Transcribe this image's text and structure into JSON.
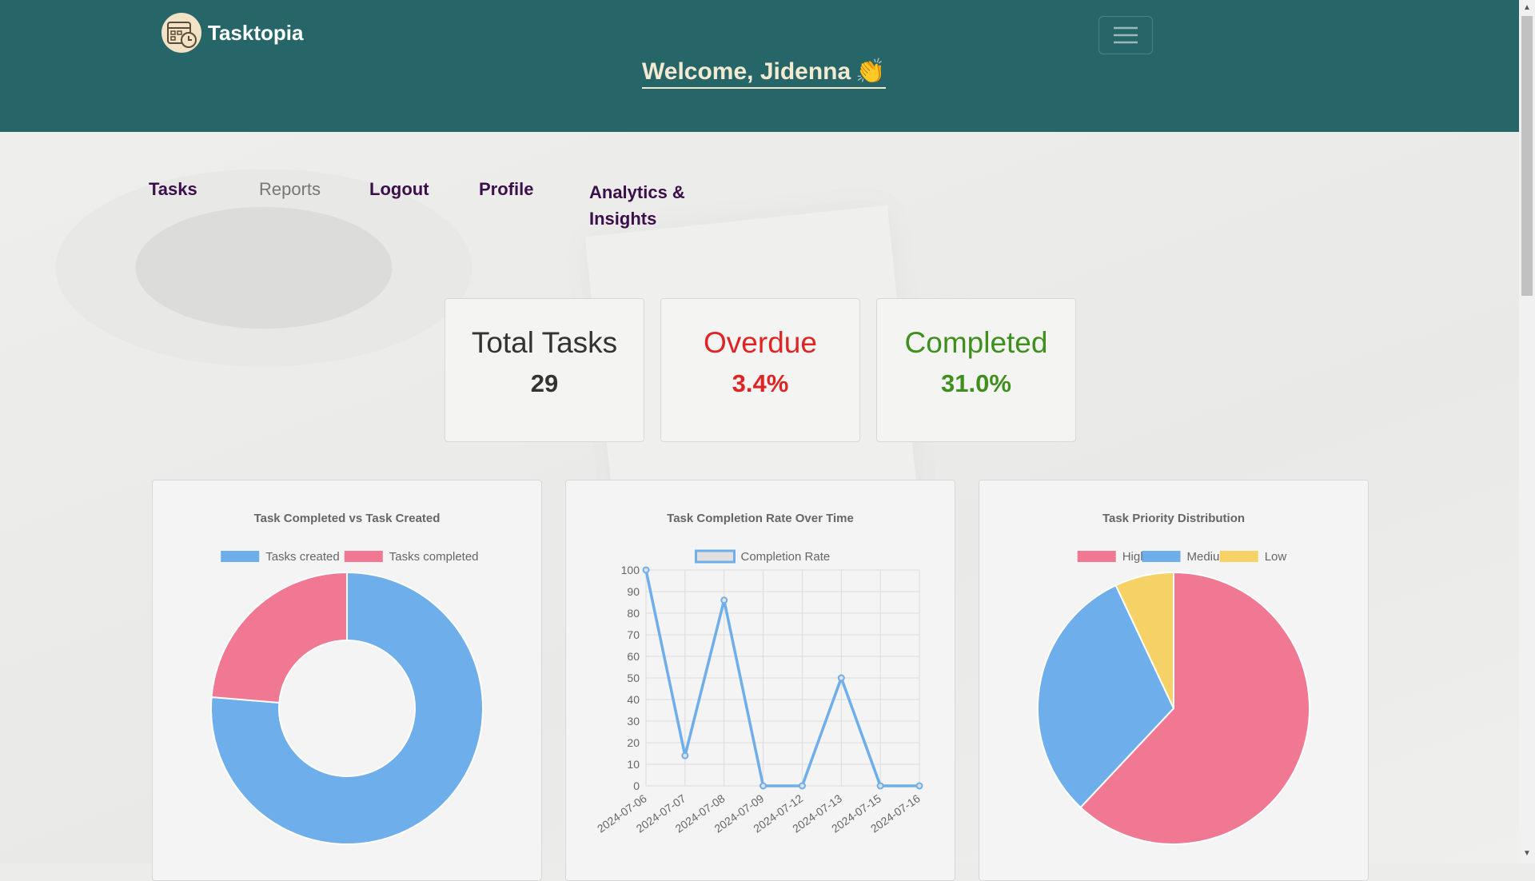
{
  "header": {
    "brand_name": "Tasktopia",
    "welcome": "Welcome, Jidenna",
    "welcome_emoji": "👏",
    "menu_icon": "hamburger-icon",
    "bg_color": "#276668"
  },
  "nav": {
    "items": [
      {
        "label": "Tasks"
      },
      {
        "label": "Reports"
      },
      {
        "label": "Logout"
      },
      {
        "label": "Profile"
      },
      {
        "label": "Analytics &"
      },
      {
        "label": "Insights"
      }
    ]
  },
  "stats": [
    {
      "title": "Total Tasks",
      "value": "29",
      "color": "#333333"
    },
    {
      "title": "Overdue",
      "value": "3.4%",
      "color": "#e02424"
    },
    {
      "title": "Completed",
      "value": "31.0%",
      "color": "#3f8f1f"
    }
  ],
  "chart_data": [
    {
      "type": "pie",
      "variant": "doughnut",
      "title": "Task Completed vs Task Created",
      "categories": [
        "Tasks created",
        "Tasks completed"
      ],
      "values": [
        29,
        9
      ],
      "colors": [
        "#6eaeea",
        "#f07892"
      ],
      "legend": "top"
    },
    {
      "type": "line",
      "title": "Task Completion Rate Over Time",
      "x": [
        "2024-07-06",
        "2024-07-07",
        "2024-07-08",
        "2024-07-09",
        "2024-07-12",
        "2024-07-13",
        "2024-07-15",
        "2024-07-16"
      ],
      "series": [
        {
          "name": "Completion Rate",
          "values": [
            100,
            14,
            86,
            0,
            0,
            50,
            0,
            0
          ]
        }
      ],
      "ylim": [
        0,
        100
      ],
      "yticks": [
        "0",
        "10",
        "20",
        "30",
        "40",
        "50",
        "60",
        "70",
        "80",
        "90",
        "100"
      ],
      "grid": true,
      "legend": "top",
      "color": "#6eaeea"
    },
    {
      "type": "pie",
      "title": "Task Priority Distribution",
      "categories": [
        "High",
        "Medium",
        "Low"
      ],
      "values": [
        62,
        31,
        7
      ],
      "colors": [
        "#f07892",
        "#6eaeea",
        "#f6d266"
      ],
      "legend": "top"
    }
  ]
}
